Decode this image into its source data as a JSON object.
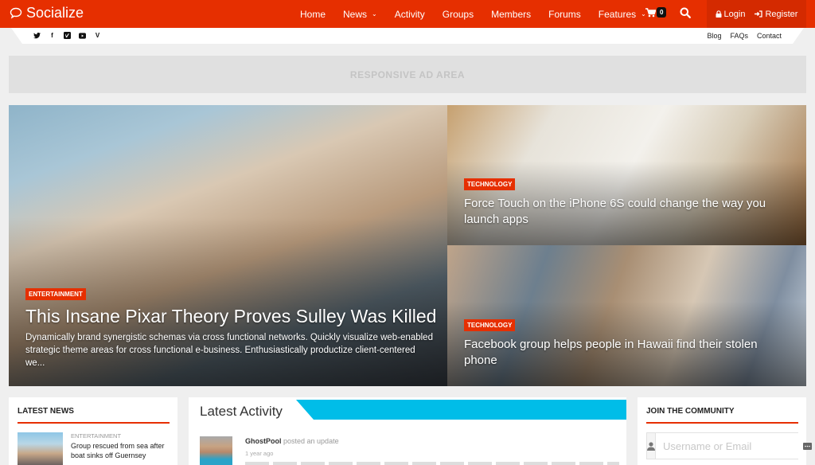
{
  "header": {
    "logo": "Socialize",
    "nav": [
      {
        "label": "Home",
        "dropdown": false
      },
      {
        "label": "News",
        "dropdown": true
      },
      {
        "label": "Activity",
        "dropdown": false
      },
      {
        "label": "Groups",
        "dropdown": false
      },
      {
        "label": "Members",
        "dropdown": false
      },
      {
        "label": "Forums",
        "dropdown": false
      },
      {
        "label": "Features",
        "dropdown": true
      }
    ],
    "cart_count": "0",
    "login_label": "Login",
    "register_label": "Register",
    "brand_color": "#e62f00"
  },
  "subbar": {
    "social_icons": [
      "twitter-icon",
      "facebook-icon",
      "vimeo-icon",
      "youtube-icon",
      "vine-icon"
    ],
    "links": [
      "Blog",
      "FAQs",
      "Contact"
    ]
  },
  "ad": {
    "label": "RESPONSIVE AD AREA"
  },
  "featured": [
    {
      "category": "ENTERTAINMENT",
      "title": "This Insane Pixar Theory Proves Sulley Was Killed",
      "excerpt": "Dynamically brand synergistic schemas via cross functional networks. Quickly visualize web-enabled strategic theme areas for cross functional e-business. Enthusiastically productize client-centered we..."
    },
    {
      "category": "TECHNOLOGY",
      "title": "Force Touch on the iPhone 6S could change the way you launch apps"
    },
    {
      "category": "TECHNOLOGY",
      "title": "Facebook group helps people in Hawaii find their stolen phone"
    }
  ],
  "latest_news": {
    "heading": "LATEST NEWS",
    "items": [
      {
        "category": "ENTERTAINMENT",
        "title": "Group rescued from sea after boat sinks off Guernsey"
      }
    ]
  },
  "latest_activity": {
    "heading": "Latest Activity",
    "accent_color": "#00bde8",
    "items": [
      {
        "user": "GhostPool",
        "action": "posted an update",
        "time": "1 year ago"
      }
    ]
  },
  "community": {
    "heading": "JOIN THE COMMUNITY",
    "username_placeholder": "Username or Email"
  }
}
